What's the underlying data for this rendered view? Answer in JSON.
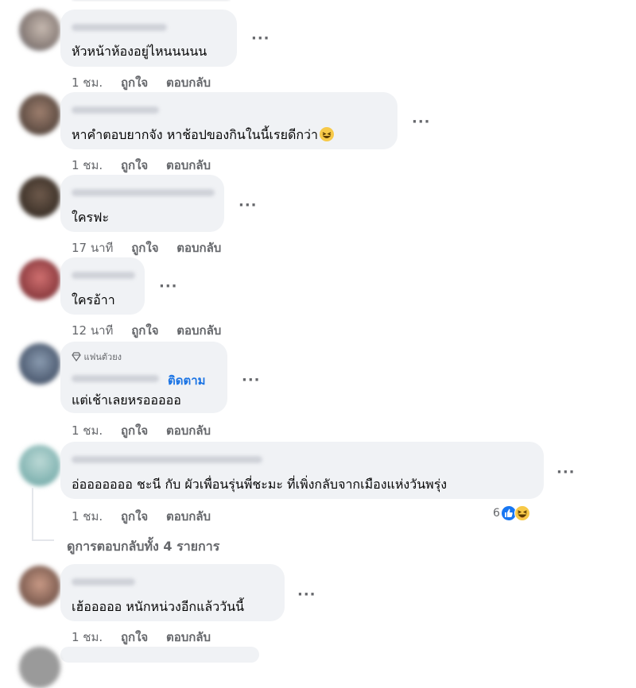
{
  "comments": [
    {
      "text": "หัวหน้าห้องอยู่ไหนนนนน",
      "time": "1 ชม.",
      "like": "ถูกใจ",
      "reply": "ตอบกลับ"
    },
    {
      "text": "หาคำตอบยากจัง หาช้อปของกินในนี้เรยดีกว่า",
      "time": "1 ชม.",
      "like": "ถูกใจ",
      "reply": "ตอบกลับ"
    },
    {
      "text": "ใครฟะ",
      "time": "17 นาที",
      "like": "ถูกใจ",
      "reply": "ตอบกลับ"
    },
    {
      "text": "ใครอ้าา",
      "time": "12 นาที",
      "like": "ถูกใจ",
      "reply": "ตอบกลับ"
    },
    {
      "text": "แต่เช้าเลยหรอออออ",
      "time": "1 ชม.",
      "like": "ถูกใจ",
      "reply": "ตอบกลับ",
      "badge": "แฟนตัวยง",
      "follow": "ติดตาม"
    },
    {
      "text": "อ่อออออออ ชะนี กับ ผัวเพื่อนรุ่นพี่ชะมะ ที่เพิ่งกลับจากเมืองแห่งวันพรุ่ง",
      "time": "1 ชม.",
      "like": "ถูกใจ",
      "reply": "ตอบกลับ",
      "reaction_count": "6"
    },
    {
      "text": "เฮ้อออออ หนักหน่วงอีกแล้ววันนี้",
      "time": "1 ชม.",
      "like": "ถูกใจ",
      "reply": "ตอบกลับ"
    }
  ],
  "view_replies": "ดูการตอบกลับทั้ง 4 รายการ",
  "more_glyph": "···",
  "icons": [
    "diamond-icon",
    "like-reaction-icon",
    "haha-reaction-icon",
    "laugh-emoji-icon"
  ],
  "colors": {
    "bubble": "#f0f2f5",
    "meta": "#65676b",
    "link": "#1b74e4",
    "like_blue": "#1877f2"
  }
}
